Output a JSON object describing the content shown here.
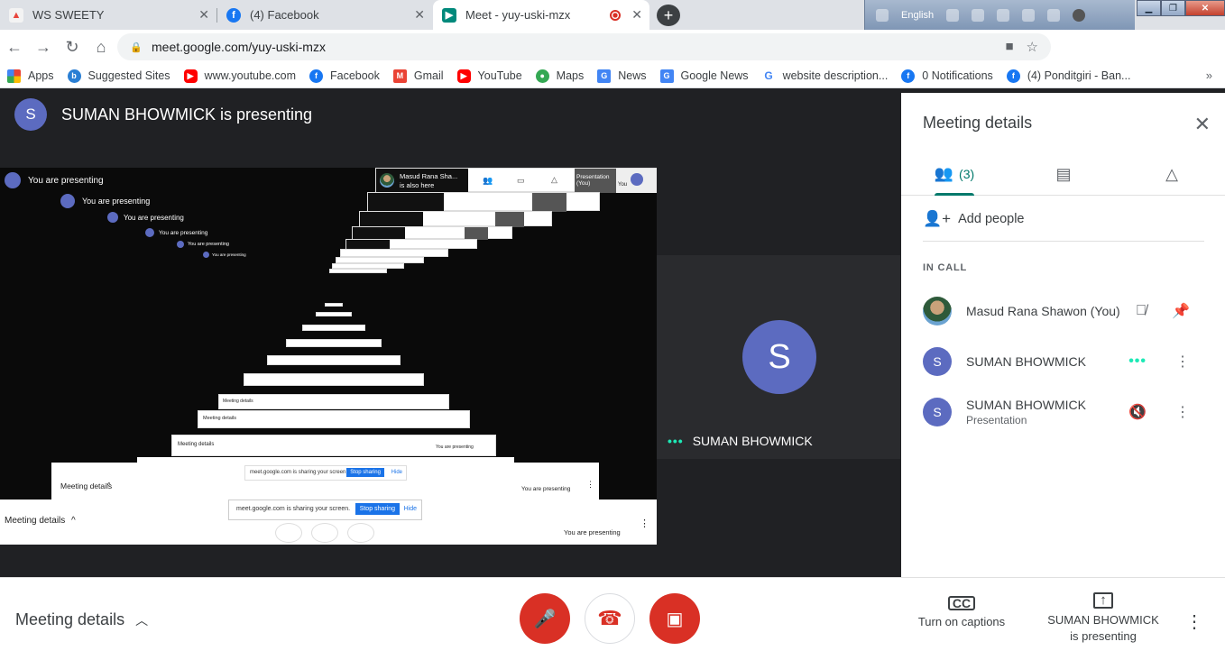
{
  "tabs": [
    {
      "label": "WS SWEETY",
      "close": "✕"
    },
    {
      "label": "(4) Facebook",
      "close": "✕"
    },
    {
      "label": "Meet - yuy-uski-mzx",
      "close": "✕"
    }
  ],
  "new_tab": "+",
  "taskbar": {
    "language": "English"
  },
  "address": {
    "url": "meet.google.com/yuy-uski-mzx"
  },
  "bookmarks": [
    {
      "label": "Apps",
      "icon": "apps-grid-icon",
      "color": "#e8453c"
    },
    {
      "label": "Suggested Sites",
      "icon": "bing-icon",
      "color": "#2a7fd4"
    },
    {
      "label": "www.youtube.com",
      "icon": "youtube-icon",
      "color": "#ff0000"
    },
    {
      "label": "Facebook",
      "icon": "facebook-icon",
      "color": "#1877f2"
    },
    {
      "label": "Gmail",
      "icon": "gmail-icon",
      "color": "#ea4335"
    },
    {
      "label": "YouTube",
      "icon": "youtube-icon",
      "color": "#ff0000"
    },
    {
      "label": "Maps",
      "icon": "maps-icon",
      "color": "#34a853"
    },
    {
      "label": "News",
      "icon": "news-icon",
      "color": "#4285f4"
    },
    {
      "label": "Google News",
      "icon": "news-icon",
      "color": "#4285f4"
    },
    {
      "label": "website description...",
      "icon": "google-icon",
      "color": "#4285f4"
    },
    {
      "label": "0 Notifications",
      "icon": "facebook-icon",
      "color": "#1877f2"
    },
    {
      "label": "(4) Ponditgiri - Ban...",
      "icon": "facebook-icon",
      "color": "#1877f2"
    }
  ],
  "bookmarks_more": "»",
  "presenter": {
    "initial": "S",
    "title": "SUMAN BHOWMICK is presenting"
  },
  "screen": {
    "you_presenting": "You are presenting",
    "meeting_details": "Meeting details",
    "sharing_text": "meet.google.com is sharing your screen.",
    "stop_sharing": "Stop sharing",
    "hide": "Hide",
    "you_are_presenting_btn": "You are presenting",
    "peer_name": "Masud Rana Sha...",
    "peer_sub": "is also here",
    "presentation_you": "Presentation (You)",
    "you": "You"
  },
  "tile": {
    "initial": "S",
    "name": "SUMAN BHOWMICK",
    "dots": "•••"
  },
  "panel": {
    "title": "Meeting details",
    "close": "✕",
    "people_count": "(3)",
    "add_people": "Add people",
    "in_call": "IN CALL",
    "participants": [
      {
        "name": "Masud Rana Shawon (You)",
        "sub": "",
        "initial": ""
      },
      {
        "name": "SUMAN BHOWMICK",
        "sub": "",
        "initial": "S"
      },
      {
        "name": "SUMAN BHOWMICK",
        "sub": "Presentation",
        "initial": "S"
      }
    ]
  },
  "bottom": {
    "meeting_details": "Meeting details",
    "captions": "Turn on captions",
    "captions_icon": "CC",
    "presenting_line1": "SUMAN BHOWMICK",
    "presenting_line2": "is presenting",
    "more": "⋮"
  },
  "colors": {
    "accent": "#00796b",
    "danger": "#d93025",
    "avatar": "#5c6bc0",
    "dots": "#1de9b6"
  }
}
